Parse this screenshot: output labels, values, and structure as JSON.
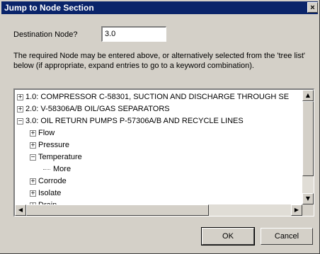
{
  "window": {
    "title": "Jump to Node Section",
    "close_glyph": "×"
  },
  "destination": {
    "label": "Destination Node?",
    "value": "3.0"
  },
  "instructions": "The required Node may be entered above, or alternatively selected from the 'tree list' below (if appropriate, expand entries to go to a keyword combination).",
  "tree": {
    "items": [
      {
        "label": "1.0: COMPRESSOR C-58301, SUCTION AND DISCHARGE THROUGH SE",
        "toggle": "+"
      },
      {
        "label": "2.0: V-58306A/B OIL/GAS SEPARATORS",
        "toggle": "+"
      },
      {
        "label": "3.0: OIL RETURN PUMPS P-57306A/B AND RECYCLE LINES",
        "toggle": "−"
      },
      {
        "label": "Flow",
        "toggle": "+"
      },
      {
        "label": "Pressure",
        "toggle": "+"
      },
      {
        "label": "Temperature",
        "toggle": "−"
      },
      {
        "label": "More",
        "toggle": ""
      },
      {
        "label": "Corrode",
        "toggle": "+"
      },
      {
        "label": "Isolate",
        "toggle": "+"
      },
      {
        "label": "Drain",
        "toggle": "+"
      }
    ]
  },
  "scroll": {
    "up": "▲",
    "down": "▼",
    "left": "◀",
    "right": "▶"
  },
  "buttons": {
    "ok": "OK",
    "cancel": "Cancel"
  }
}
